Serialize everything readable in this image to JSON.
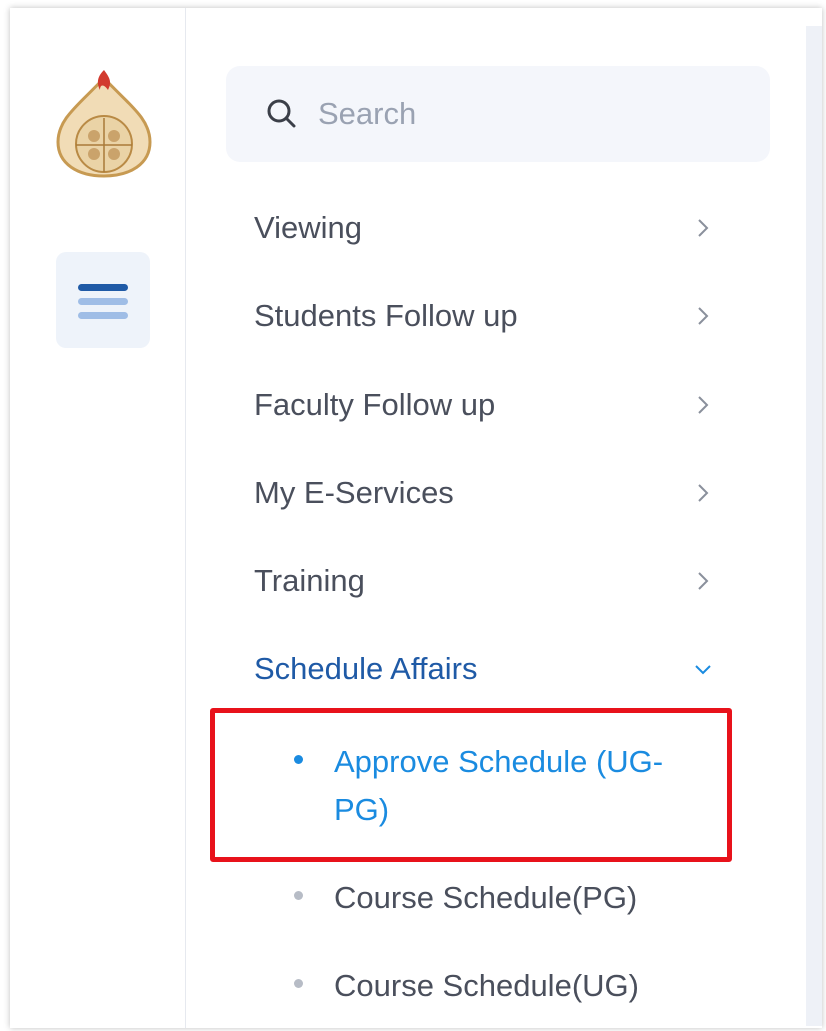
{
  "search": {
    "placeholder": "Search",
    "icon": "search-icon"
  },
  "nav": {
    "items": [
      {
        "label": "Viewing",
        "icon": "chevron-right-icon",
        "expanded": false
      },
      {
        "label": "Students Follow up",
        "icon": "chevron-right-icon",
        "expanded": false
      },
      {
        "label": "Faculty Follow up",
        "icon": "chevron-right-icon",
        "expanded": false
      },
      {
        "label": "My E-Services",
        "icon": "chevron-right-icon",
        "expanded": false
      },
      {
        "label": "Training",
        "icon": "chevron-right-icon",
        "expanded": false
      },
      {
        "label": "Schedule Affairs",
        "icon": "chevron-down-icon",
        "expanded": true
      }
    ],
    "sub_items": [
      {
        "label": "Approve Schedule (UG-PG)",
        "selected": true
      },
      {
        "label": "Course Schedule(PG)",
        "selected": false
      },
      {
        "label": "Course Schedule(UG)",
        "selected": false
      }
    ]
  },
  "colors": {
    "accent": "#1a8be0",
    "section_active": "#1f5aa6",
    "highlight_box": "#e8121b",
    "menu_bar_dark": "#1f5aa6",
    "menu_bar_light": "#9fbde6"
  }
}
